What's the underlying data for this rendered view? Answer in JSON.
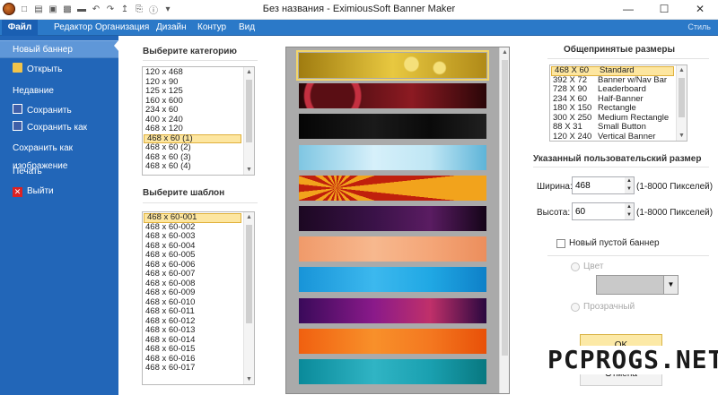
{
  "window": {
    "title": "Без названия - EximiousSoft Banner Maker",
    "minimize": "—",
    "maximize": "☐",
    "close": "✕"
  },
  "qat_icons": [
    "new-file-icon",
    "open-folder-icon",
    "save-icon",
    "save-as-icon",
    "image-icon",
    "undo-icon",
    "redo-icon",
    "arrow-icon",
    "print-icon",
    "help-icon",
    "dropdown-icon"
  ],
  "ribbon": {
    "tabs": [
      "Файл",
      "Редактор",
      "Организация",
      "Дизайн",
      "Контур",
      "Вид"
    ],
    "right_label": "Стиль"
  },
  "backstage": {
    "items": [
      {
        "label": "Новый баннер",
        "icon": "",
        "selected": true
      },
      {
        "label": "Открыть",
        "icon": "folder-icon"
      },
      {
        "label": "Недавние",
        "icon": ""
      },
      {
        "label": "Сохранить",
        "icon": "save-icon"
      },
      {
        "label": "Сохранить как",
        "icon": "save-as-icon"
      },
      {
        "label": "Сохранить как изображение",
        "icon": ""
      },
      {
        "label": "Печать",
        "icon": ""
      },
      {
        "label": "Выйти",
        "icon": "exit-icon"
      }
    ]
  },
  "category": {
    "title": "Выберите категорию",
    "items": [
      "120 x 468",
      "120 x 90",
      "125 x 125",
      "160 x 600",
      "234 x 60",
      "400 x 240",
      "468 x 120",
      "468 x 60 (1)",
      "468 x 60 (2)",
      "468 x 60 (3)",
      "468 x 60 (4)"
    ],
    "selected_index": 7
  },
  "template": {
    "title": "Выберите шаблон",
    "items": [
      "468 x 60-001",
      "468 x 60-002",
      "468 x 60-003",
      "468 x 60-004",
      "468 x 60-005",
      "468 x 60-006",
      "468 x 60-007",
      "468 x 60-008",
      "468 x 60-009",
      "468 x 60-010",
      "468 x 60-011",
      "468 x 60-012",
      "468 x 60-013",
      "468 x 60-014",
      "468 x 60-015",
      "468 x 60-016",
      "468 x 60-017"
    ],
    "selected_index": 0
  },
  "gallery": {
    "banners": [
      {
        "name": "gold-bubbles",
        "colors": [
          "#a07c10",
          "#e8c840",
          "#f5e07a",
          "#b08a18"
        ]
      },
      {
        "name": "red-circles",
        "colors": [
          "#2a0608",
          "#8c1a22",
          "#c43040",
          "#5a0e14"
        ]
      },
      {
        "name": "black-silhouette",
        "colors": [
          "#050505",
          "#1a1a1a",
          "#0a0a0a",
          "#202020"
        ]
      },
      {
        "name": "light-blue-waves",
        "colors": [
          "#7fc6e2",
          "#d6f0fa",
          "#bfe6f4",
          "#5eb4d8"
        ]
      },
      {
        "name": "red-sunburst",
        "colors": [
          "#c0200c",
          "#f2a31c",
          "#e0501a",
          "#9a1208"
        ]
      },
      {
        "name": "purple-sparkles",
        "colors": [
          "#1c0822",
          "#3a1248",
          "#5a1c62",
          "#140418"
        ]
      },
      {
        "name": "peach-flowers",
        "colors": [
          "#f09a6a",
          "#f7b88e",
          "#f4a678",
          "#ec8e5c"
        ]
      },
      {
        "name": "cyan-splash",
        "colors": [
          "#1894d8",
          "#3cb8ee",
          "#20a8e4",
          "#0e80c8"
        ]
      },
      {
        "name": "purple-gradient",
        "colors": [
          "#3a0a5a",
          "#8a1a8a",
          "#c0306a",
          "#2a0840"
        ]
      },
      {
        "name": "orange-waves",
        "colors": [
          "#f06010",
          "#f8902a",
          "#f47820",
          "#e85008"
        ]
      },
      {
        "name": "teal-swirls",
        "colors": [
          "#0a8a9a",
          "#30b4c4",
          "#1aa0b0",
          "#087880"
        ]
      }
    ]
  },
  "sizes": {
    "title": "Общепринятые размеры",
    "items": [
      {
        "size": "468 X 60",
        "name": "Standard"
      },
      {
        "size": "392 X 72",
        "name": "Banner w/Nav Bar"
      },
      {
        "size": "728 X 90",
        "name": "Leaderboard"
      },
      {
        "size": "234 X 60",
        "name": "Half-Banner"
      },
      {
        "size": "180 X 150",
        "name": "Rectangle"
      },
      {
        "size": "300 X 250",
        "name": "Medium Rectangle"
      },
      {
        "size": "88 X 31",
        "name": "Small Button"
      },
      {
        "size": "120 X 240",
        "name": "Vertical Banner"
      }
    ],
    "selected_index": 0
  },
  "custom": {
    "title": "Указанный пользовательский размер",
    "width_label": "Ширина:",
    "width_value": "468",
    "width_range": "(1-8000 Пикселей)",
    "height_label": "Высота:",
    "height_value": "60",
    "height_range": "(1-8000 Пикселей)"
  },
  "blank": {
    "label": "Новый пустой баннер",
    "color_label": "Цвет",
    "transparent_label": "Прозрачный"
  },
  "buttons": {
    "ok": "OK",
    "cancel": "Отмена"
  },
  "watermark": "PCPROGS.NET"
}
